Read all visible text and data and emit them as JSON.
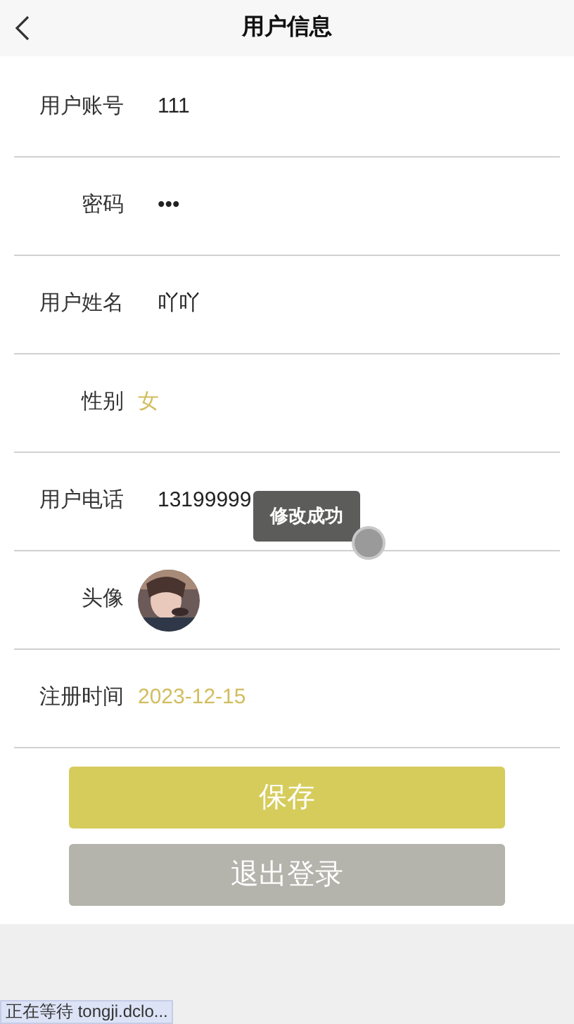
{
  "header": {
    "title": "用户信息"
  },
  "fields": [
    {
      "label": "用户账号",
      "value": "111",
      "kind": "text"
    },
    {
      "label": "密码",
      "value": "•••",
      "kind": "text"
    },
    {
      "label": "用户姓名",
      "value": "吖吖",
      "kind": "text"
    },
    {
      "label": "性别",
      "value": "女",
      "kind": "accent"
    },
    {
      "label": "用户电话",
      "value": "13199999",
      "kind": "text"
    },
    {
      "label": "头像",
      "kind": "avatar"
    },
    {
      "label": "注册时间",
      "value": "2023-12-15",
      "kind": "accent"
    }
  ],
  "buttons": [
    {
      "label": "保存",
      "kind": "primary"
    },
    {
      "label": "退出登录",
      "kind": "secondary"
    }
  ],
  "toast": "修改成功",
  "status_bar": "正在等待 tongji.dclo..."
}
